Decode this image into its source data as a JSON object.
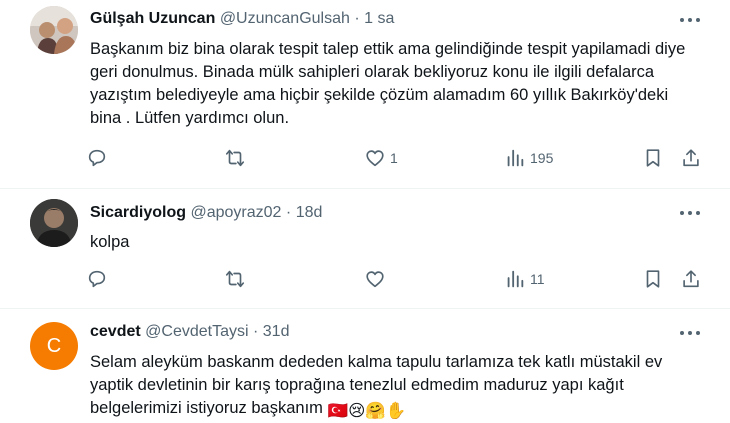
{
  "tweets": [
    {
      "name": "Gülşah Uzuncan",
      "handle": "@UzuncanGulsah",
      "separator": "·",
      "time": "1 sa",
      "text": "Başkanım biz bina olarak tespit talep ettik ama gelindiğinde tespit yapilamadi diye geri donulmus. Binada mülk sahipleri olarak bekliyoruz konu ile ilgili defalarca yazıştım belediyeyle ama hiçbir şekilde çözüm alamadım 60 yıllık Bakırköy'deki bina . Lütfen yardımcı olun.",
      "reply_count": "",
      "retweet_count": "",
      "like_count": "1",
      "view_count": "195"
    },
    {
      "name": "Sicardiyolog",
      "handle": "@apoyraz02",
      "separator": "·",
      "time": "18d",
      "text": "kolpa",
      "reply_count": "",
      "retweet_count": "",
      "like_count": "",
      "view_count": "11"
    },
    {
      "name": "cevdet",
      "handle": "@CevdetTaysi",
      "separator": "·",
      "time": "31d",
      "avatar_letter": "C",
      "text": "Selam aleyküm baskanm dededen kalma tapulu tarlamıza tek katlı müstakil ev yaptik devletinin bir karış toprağına tenezlul edmedim maduruz yapı kağıt belgelerimizi istiyoruz başkanım",
      "emojis": [
        "🇹🇷",
        "😢",
        "🤗",
        "✋"
      ]
    }
  ],
  "colors": {
    "text": "#0f1419",
    "secondary": "#536471",
    "divider": "#eff3f4",
    "avatar_orange": "#f57c00"
  }
}
